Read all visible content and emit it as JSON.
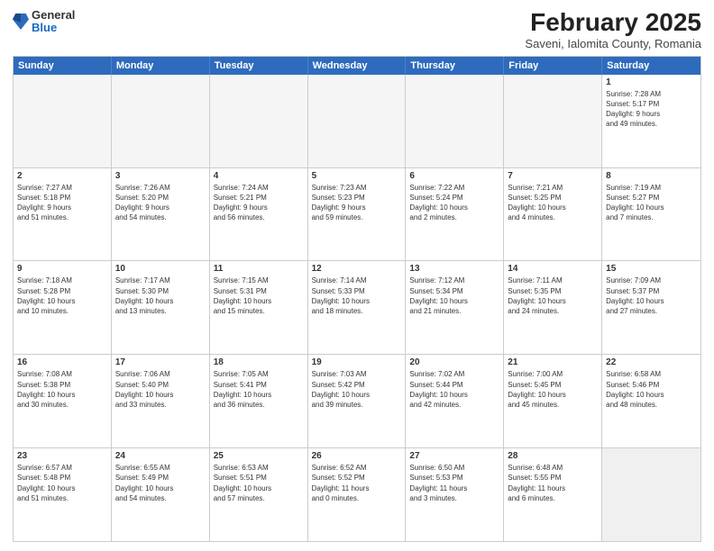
{
  "logo": {
    "general": "General",
    "blue": "Blue"
  },
  "title": {
    "month": "February 2025",
    "location": "Saveni, Ialomita County, Romania"
  },
  "weekdays": [
    "Sunday",
    "Monday",
    "Tuesday",
    "Wednesday",
    "Thursday",
    "Friday",
    "Saturday"
  ],
  "rows": [
    [
      {
        "day": "",
        "info": "",
        "empty": true
      },
      {
        "day": "",
        "info": "",
        "empty": true
      },
      {
        "day": "",
        "info": "",
        "empty": true
      },
      {
        "day": "",
        "info": "",
        "empty": true
      },
      {
        "day": "",
        "info": "",
        "empty": true
      },
      {
        "day": "",
        "info": "",
        "empty": true
      },
      {
        "day": "1",
        "info": "Sunrise: 7:28 AM\nSunset: 5:17 PM\nDaylight: 9 hours\nand 49 minutes."
      }
    ],
    [
      {
        "day": "2",
        "info": "Sunrise: 7:27 AM\nSunset: 5:18 PM\nDaylight: 9 hours\nand 51 minutes."
      },
      {
        "day": "3",
        "info": "Sunrise: 7:26 AM\nSunset: 5:20 PM\nDaylight: 9 hours\nand 54 minutes."
      },
      {
        "day": "4",
        "info": "Sunrise: 7:24 AM\nSunset: 5:21 PM\nDaylight: 9 hours\nand 56 minutes."
      },
      {
        "day": "5",
        "info": "Sunrise: 7:23 AM\nSunset: 5:23 PM\nDaylight: 9 hours\nand 59 minutes."
      },
      {
        "day": "6",
        "info": "Sunrise: 7:22 AM\nSunset: 5:24 PM\nDaylight: 10 hours\nand 2 minutes."
      },
      {
        "day": "7",
        "info": "Sunrise: 7:21 AM\nSunset: 5:25 PM\nDaylight: 10 hours\nand 4 minutes."
      },
      {
        "day": "8",
        "info": "Sunrise: 7:19 AM\nSunset: 5:27 PM\nDaylight: 10 hours\nand 7 minutes."
      }
    ],
    [
      {
        "day": "9",
        "info": "Sunrise: 7:18 AM\nSunset: 5:28 PM\nDaylight: 10 hours\nand 10 minutes."
      },
      {
        "day": "10",
        "info": "Sunrise: 7:17 AM\nSunset: 5:30 PM\nDaylight: 10 hours\nand 13 minutes."
      },
      {
        "day": "11",
        "info": "Sunrise: 7:15 AM\nSunset: 5:31 PM\nDaylight: 10 hours\nand 15 minutes."
      },
      {
        "day": "12",
        "info": "Sunrise: 7:14 AM\nSunset: 5:33 PM\nDaylight: 10 hours\nand 18 minutes."
      },
      {
        "day": "13",
        "info": "Sunrise: 7:12 AM\nSunset: 5:34 PM\nDaylight: 10 hours\nand 21 minutes."
      },
      {
        "day": "14",
        "info": "Sunrise: 7:11 AM\nSunset: 5:35 PM\nDaylight: 10 hours\nand 24 minutes."
      },
      {
        "day": "15",
        "info": "Sunrise: 7:09 AM\nSunset: 5:37 PM\nDaylight: 10 hours\nand 27 minutes."
      }
    ],
    [
      {
        "day": "16",
        "info": "Sunrise: 7:08 AM\nSunset: 5:38 PM\nDaylight: 10 hours\nand 30 minutes."
      },
      {
        "day": "17",
        "info": "Sunrise: 7:06 AM\nSunset: 5:40 PM\nDaylight: 10 hours\nand 33 minutes."
      },
      {
        "day": "18",
        "info": "Sunrise: 7:05 AM\nSunset: 5:41 PM\nDaylight: 10 hours\nand 36 minutes."
      },
      {
        "day": "19",
        "info": "Sunrise: 7:03 AM\nSunset: 5:42 PM\nDaylight: 10 hours\nand 39 minutes."
      },
      {
        "day": "20",
        "info": "Sunrise: 7:02 AM\nSunset: 5:44 PM\nDaylight: 10 hours\nand 42 minutes."
      },
      {
        "day": "21",
        "info": "Sunrise: 7:00 AM\nSunset: 5:45 PM\nDaylight: 10 hours\nand 45 minutes."
      },
      {
        "day": "22",
        "info": "Sunrise: 6:58 AM\nSunset: 5:46 PM\nDaylight: 10 hours\nand 48 minutes."
      }
    ],
    [
      {
        "day": "23",
        "info": "Sunrise: 6:57 AM\nSunset: 5:48 PM\nDaylight: 10 hours\nand 51 minutes."
      },
      {
        "day": "24",
        "info": "Sunrise: 6:55 AM\nSunset: 5:49 PM\nDaylight: 10 hours\nand 54 minutes."
      },
      {
        "day": "25",
        "info": "Sunrise: 6:53 AM\nSunset: 5:51 PM\nDaylight: 10 hours\nand 57 minutes."
      },
      {
        "day": "26",
        "info": "Sunrise: 6:52 AM\nSunset: 5:52 PM\nDaylight: 11 hours\nand 0 minutes."
      },
      {
        "day": "27",
        "info": "Sunrise: 6:50 AM\nSunset: 5:53 PM\nDaylight: 11 hours\nand 3 minutes."
      },
      {
        "day": "28",
        "info": "Sunrise: 6:48 AM\nSunset: 5:55 PM\nDaylight: 11 hours\nand 6 minutes."
      },
      {
        "day": "",
        "info": "",
        "empty": true,
        "shaded": true
      }
    ]
  ]
}
